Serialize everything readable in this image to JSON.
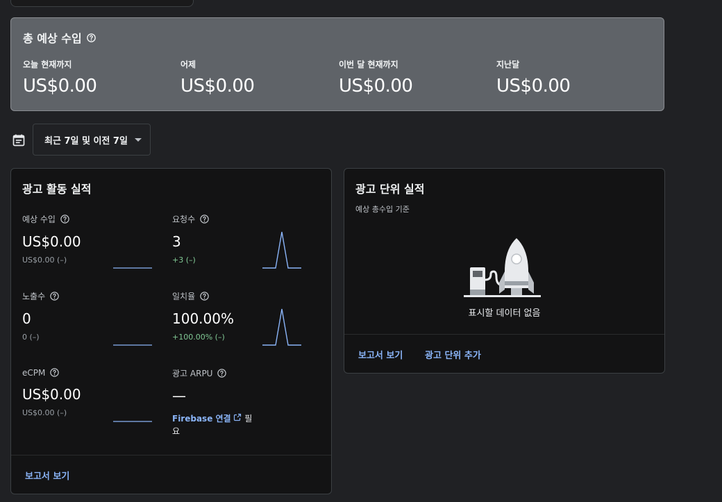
{
  "earnings": {
    "title": "총 예상 수입",
    "columns": [
      {
        "label": "오늘 현재까지",
        "value": "US$0.00"
      },
      {
        "label": "어제",
        "value": "US$0.00"
      },
      {
        "label": "이번 달 현재까지",
        "value": "US$0.00"
      },
      {
        "label": "지난달",
        "value": "US$0.00"
      }
    ]
  },
  "date_range": {
    "label": "최근 7일 및 이전 7일",
    "icon": "calendar-icon"
  },
  "performance": {
    "title": "광고 활동 실적",
    "metrics": [
      {
        "label": "예상 수입",
        "value": "US$0.00",
        "sub": "US$0.00 (–)"
      },
      {
        "label": "요청수",
        "value": "3",
        "sub": "+3 (–)"
      },
      {
        "label": "노출수",
        "value": "0",
        "sub": "0 (–)"
      },
      {
        "label": "일치율",
        "value": "100.00%",
        "sub": "+100.00% (–)"
      },
      {
        "label": "eCPM",
        "value": "US$0.00",
        "sub": "US$0.00 (–)"
      },
      {
        "label": "광고 ARPU",
        "value": "—",
        "firebase_link": "Firebase 연결",
        "firebase_suffix": "필요"
      }
    ],
    "footer_link": "보고서 보기"
  },
  "ad_units": {
    "title": "광고 단위 실적",
    "subtitle": "예상 총수입 기준",
    "empty_text": "표시할 데이터 없음",
    "links": [
      "보고서 보기",
      "광고 단위 추가"
    ]
  },
  "colors": {
    "accent": "#8ab4f8",
    "spark": "#8ab4f8",
    "positive": "#81c995"
  }
}
